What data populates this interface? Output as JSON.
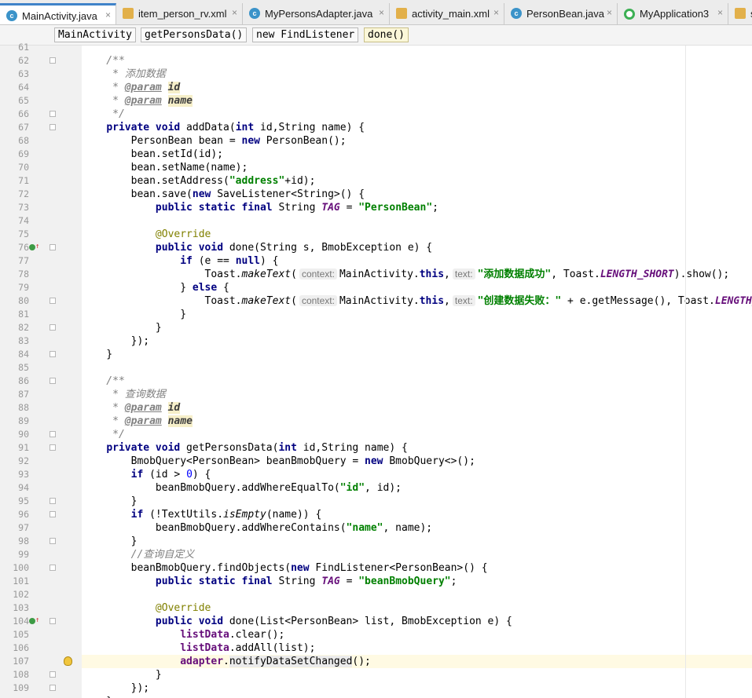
{
  "tabs": [
    {
      "label": "MainActivity.java",
      "type": "class",
      "active": true
    },
    {
      "label": "item_person_rv.xml",
      "type": "xml",
      "active": false
    },
    {
      "label": "MyPersonsAdapter.java",
      "type": "class",
      "active": false
    },
    {
      "label": "activity_main.xml",
      "type": "xml",
      "active": false
    },
    {
      "label": "PersonBean.java",
      "type": "class",
      "active": false
    },
    {
      "label": "MyApplication3",
      "type": "app",
      "active": false
    },
    {
      "label": "s",
      "type": "xml",
      "active": false
    }
  ],
  "close_glyph": "×",
  "breadcrumbs": [
    "MainActivity",
    "getPersonsData()",
    "new FindListener",
    "done()"
  ],
  "gutter": {
    "line_numbers": [
      "61",
      "62",
      "63",
      "64",
      "65",
      "66",
      "67",
      "68",
      "69",
      "70",
      "71",
      "72",
      "73",
      "74",
      "75",
      "76",
      "77",
      "78",
      "79",
      "80",
      "81",
      "82",
      "83",
      "84",
      "85",
      "86",
      "87",
      "88",
      "89",
      "90",
      "91",
      "92",
      "93",
      "94",
      "95",
      "96",
      "97",
      "98",
      "99",
      "100",
      "101",
      "102",
      "103",
      "104",
      "105",
      "106",
      "107",
      "108",
      "109"
    ],
    "fold_lines": [
      "62",
      "66",
      "67",
      "76",
      "80",
      "82",
      "84",
      "86",
      "90",
      "91",
      "95",
      "96",
      "98",
      "100",
      "104",
      "108",
      "109"
    ],
    "override_markers": [
      "76",
      "104"
    ],
    "bulb_line": "107"
  },
  "code_lines": [
    [],
    [
      [
        "    /**",
        "cm"
      ]
    ],
    [
      [
        "     * 添加数据",
        "cm"
      ]
    ],
    [
      [
        "     * ",
        "cm"
      ],
      [
        "@param",
        "tag"
      ],
      [
        " ",
        "cm"
      ],
      [
        "id",
        "prm"
      ]
    ],
    [
      [
        "     * ",
        "cm"
      ],
      [
        "@param",
        "tag"
      ],
      [
        " ",
        "cm"
      ],
      [
        "name",
        "prm"
      ]
    ],
    [
      [
        "     */",
        "cm"
      ]
    ],
    [
      [
        "    ",
        ""
      ],
      [
        "private void",
        "kw"
      ],
      [
        " addData(",
        ""
      ],
      [
        "int",
        "kw"
      ],
      [
        " id,String name) {",
        ""
      ]
    ],
    [
      [
        "        PersonBean bean = ",
        ""
      ],
      [
        "new",
        "kw"
      ],
      [
        " PersonBean();",
        ""
      ]
    ],
    [
      [
        "        bean.setId(id);",
        ""
      ]
    ],
    [
      [
        "        bean.setName(name);",
        ""
      ]
    ],
    [
      [
        "        bean.setAddress(",
        ""
      ],
      [
        "\"address\"",
        "str"
      ],
      [
        "+id);",
        ""
      ]
    ],
    [
      [
        "        bean.save(",
        ""
      ],
      [
        "new",
        "kw"
      ],
      [
        " SaveListener<String>() {",
        ""
      ]
    ],
    [
      [
        "            ",
        ""
      ],
      [
        "public static final",
        "kw"
      ],
      [
        " String ",
        ""
      ],
      [
        "TAG",
        "sfield"
      ],
      [
        " = ",
        ""
      ],
      [
        "\"PersonBean\"",
        "str"
      ],
      [
        ";",
        ""
      ]
    ],
    [],
    [
      [
        "            ",
        ""
      ],
      [
        "@Override",
        "ann"
      ]
    ],
    [
      [
        "            ",
        ""
      ],
      [
        "public void",
        "kw"
      ],
      [
        " done(String s, BmobException e) {",
        ""
      ]
    ],
    [
      [
        "                ",
        ""
      ],
      [
        "if",
        "kw"
      ],
      [
        " (e == ",
        ""
      ],
      [
        "null",
        "kw"
      ],
      [
        ") {",
        ""
      ]
    ],
    [
      [
        "                    Toast.",
        ""
      ],
      [
        "makeText",
        "ital"
      ],
      [
        "(",
        ""
      ],
      [
        "context:",
        "hint"
      ],
      [
        "MainActivity.",
        ""
      ],
      [
        "this",
        "kw"
      ],
      [
        ",",
        ""
      ],
      [
        "text:",
        "hint"
      ],
      [
        "\"添加数据成功\"",
        "str"
      ],
      [
        ", Toast.",
        ""
      ],
      [
        "LENGTH_SHORT",
        "sfield"
      ],
      [
        ").show();",
        ""
      ]
    ],
    [
      [
        "                } ",
        ""
      ],
      [
        "else",
        "kw"
      ],
      [
        " {",
        ""
      ]
    ],
    [
      [
        "                    Toast.",
        ""
      ],
      [
        "makeText",
        "ital"
      ],
      [
        "(",
        ""
      ],
      [
        "context:",
        "hint"
      ],
      [
        "MainActivity.",
        ""
      ],
      [
        "this",
        "kw"
      ],
      [
        ",",
        ""
      ],
      [
        "text:",
        "hint"
      ],
      [
        "\"创建数据失败：\"",
        "str"
      ],
      [
        " + e.getMessage(), Toast.",
        ""
      ],
      [
        "LENGTH_SHORT",
        "sfield"
      ],
      [
        ").show();",
        ""
      ]
    ],
    [
      [
        "                }",
        ""
      ]
    ],
    [
      [
        "            }",
        ""
      ]
    ],
    [
      [
        "        });",
        ""
      ]
    ],
    [
      [
        "    }",
        ""
      ]
    ],
    [],
    [
      [
        "    /**",
        "cm"
      ]
    ],
    [
      [
        "     * 查询数据",
        "cm"
      ]
    ],
    [
      [
        "     * ",
        "cm"
      ],
      [
        "@param",
        "tag"
      ],
      [
        " ",
        "cm"
      ],
      [
        "id",
        "prm"
      ]
    ],
    [
      [
        "     * ",
        "cm"
      ],
      [
        "@param",
        "tag"
      ],
      [
        " ",
        "cm"
      ],
      [
        "name",
        "prm"
      ]
    ],
    [
      [
        "     */",
        "cm"
      ]
    ],
    [
      [
        "    ",
        ""
      ],
      [
        "private void",
        "kw"
      ],
      [
        " getPersonsData(",
        ""
      ],
      [
        "int",
        "kw"
      ],
      [
        " id,String name) {",
        ""
      ]
    ],
    [
      [
        "        BmobQuery<PersonBean> beanBmobQuery = ",
        ""
      ],
      [
        "new",
        "kw"
      ],
      [
        " BmobQuery<>();",
        ""
      ]
    ],
    [
      [
        "        ",
        ""
      ],
      [
        "if",
        "kw"
      ],
      [
        " (id > ",
        ""
      ],
      [
        "0",
        "num"
      ],
      [
        ") {",
        ""
      ]
    ],
    [
      [
        "            beanBmobQuery.addWhereEqualTo(",
        ""
      ],
      [
        "\"id\"",
        "str"
      ],
      [
        ", id);",
        ""
      ]
    ],
    [
      [
        "        }",
        ""
      ]
    ],
    [
      [
        "        ",
        ""
      ],
      [
        "if",
        "kw"
      ],
      [
        " (!TextUtils.",
        ""
      ],
      [
        "isEmpty",
        "ital"
      ],
      [
        "(name)) {",
        ""
      ]
    ],
    [
      [
        "            beanBmobQuery.addWhereContains(",
        ""
      ],
      [
        "\"name\"",
        "str"
      ],
      [
        ", name);",
        ""
      ]
    ],
    [
      [
        "        }",
        ""
      ]
    ],
    [
      [
        "        //查询自定义",
        "cm"
      ]
    ],
    [
      [
        "        beanBmobQuery.findObjects(",
        ""
      ],
      [
        "new",
        "kw"
      ],
      [
        " FindListener<PersonBean>() {",
        ""
      ]
    ],
    [
      [
        "            ",
        ""
      ],
      [
        "public static final",
        "kw"
      ],
      [
        " String ",
        ""
      ],
      [
        "TAG",
        "sfield"
      ],
      [
        " = ",
        ""
      ],
      [
        "\"beanBmobQuery\"",
        "str"
      ],
      [
        ";",
        ""
      ]
    ],
    [],
    [
      [
        "            ",
        ""
      ],
      [
        "@Override",
        "ann"
      ]
    ],
    [
      [
        "            ",
        ""
      ],
      [
        "public void",
        "kw"
      ],
      [
        " done(List<PersonBean> list, BmobException e) {",
        ""
      ]
    ],
    [
      [
        "                ",
        ""
      ],
      [
        "listData",
        "fld"
      ],
      [
        ".clear();",
        ""
      ]
    ],
    [
      [
        "                ",
        ""
      ],
      [
        "listData",
        "fld"
      ],
      [
        ".addAll(list);",
        ""
      ]
    ],
    [
      [
        "                ",
        ""
      ],
      [
        "adapter",
        "fld"
      ],
      [
        ".",
        ""
      ],
      [
        "notifyDataSetChanged",
        "selw"
      ],
      [
        "();",
        ""
      ]
    ],
    [
      [
        "            }",
        ""
      ]
    ],
    [
      [
        "        });",
        ""
      ]
    ]
  ],
  "highlight_line": "107",
  "partial_last_line": "    }"
}
